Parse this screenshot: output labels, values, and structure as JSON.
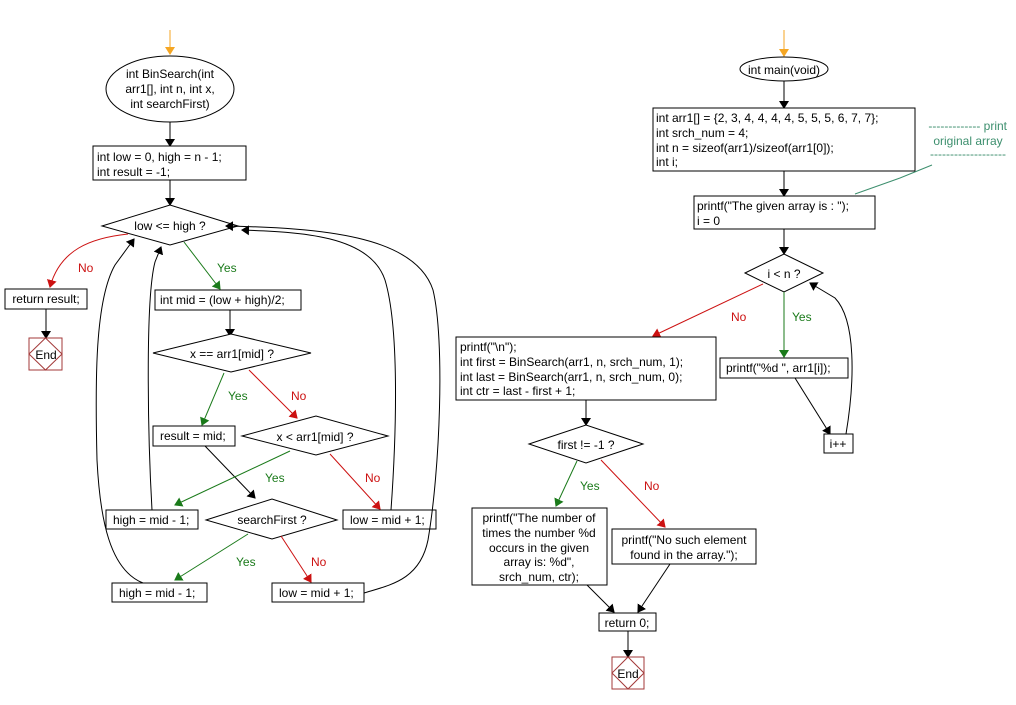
{
  "diagram": {
    "type": "flowchart",
    "colors": {
      "default": "#000000",
      "yes": "#1a7a1a",
      "no": "#cc1111",
      "start_arrow": "#f5a623",
      "end_terminator": "#a33a3a",
      "annotation": "#3d8f6e"
    },
    "binsearch": {
      "start": [
        "int BinSearch(int",
        "arr1[], int n, int x,",
        "int searchFirst)"
      ],
      "init": [
        "int low = 0, high = n - 1;",
        "int result = -1;"
      ],
      "loop_cond": "low <= high ?",
      "return_result": "return result;",
      "end": "End",
      "mid": "int mid = (low + high)/2;",
      "eq_cond": "x == arr1[mid] ?",
      "result_mid": "result = mid;",
      "lt_cond": "x < arr1[mid] ?",
      "high_dec_a": "high = mid - 1;",
      "low_inc_a": "low = mid + 1;",
      "search_first": "searchFirst ?",
      "high_dec_b": "high = mid - 1;",
      "low_inc_b": "low = mid + 1;"
    },
    "main": {
      "start": "int main(void)",
      "decl": [
        "int arr1[] = {2, 3, 4, 4, 4, 4, 5, 5, 5, 6, 7, 7};",
        "int srch_num = 4;",
        "int n = sizeof(arr1)/sizeof(arr1[0]);",
        "int i;"
      ],
      "print_intro": [
        "printf(\"The given array is :  \");",
        "i = 0"
      ],
      "annotation": [
        "------------- print",
        "original array",
        "-------------------"
      ],
      "loop_cond": "i < n ?",
      "print_elem": "printf(\"%d  \", arr1[i]);",
      "increment": "i++",
      "search": [
        "printf(\"\\n\");",
        "int first = BinSearch(arr1, n, srch_num, 1);",
        "int last = BinSearch(arr1, n, srch_num, 0);",
        "int ctr = last - first + 1;"
      ],
      "found_cond": "first != -1 ?",
      "print_count": [
        "printf(\"The number of",
        "times the number %d",
        "occurs in the given",
        "array is:  %d\",",
        "srch_num, ctr);"
      ],
      "print_none": [
        "printf(\"No such element",
        "found in the array.\");"
      ],
      "return_zero": "return 0;",
      "end": "End"
    },
    "labels": {
      "yes": "Yes",
      "no": "No"
    }
  }
}
